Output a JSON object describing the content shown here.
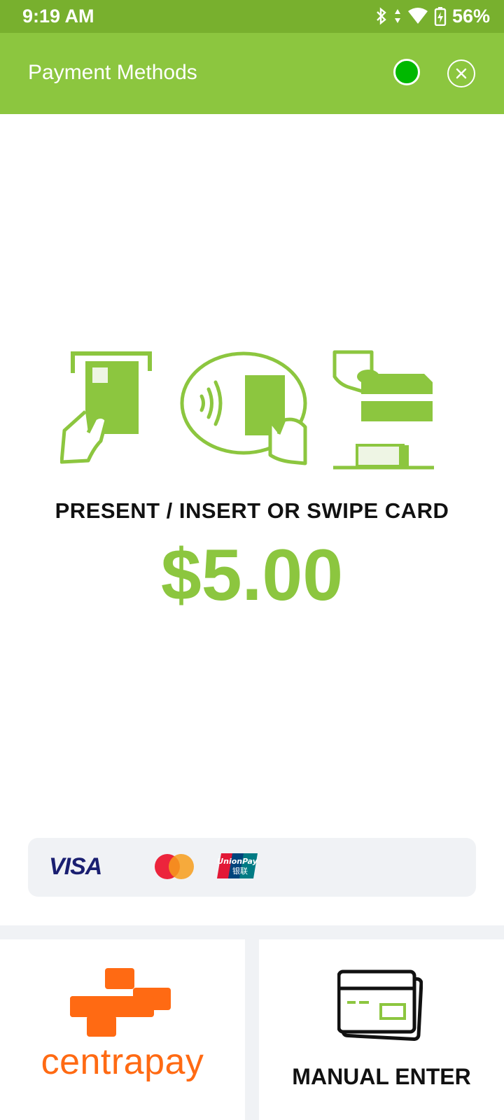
{
  "status_bar": {
    "time": "9:19 AM",
    "battery_percent": "56%",
    "icons": [
      "bluetooth-icon",
      "data-arrows-icon",
      "wifi-icon",
      "battery-charging-icon"
    ]
  },
  "app_bar": {
    "title": "Payment Methods",
    "status_indicator_color": "#00b800",
    "close_icon": "close-icon"
  },
  "main": {
    "instruction": "PRESENT / INSERT OR SWIPE CARD",
    "amount": "$5.00",
    "accent_color": "#8cc63f",
    "illustrations": [
      "insert-card-icon",
      "contactless-tap-icon",
      "swipe-card-icon"
    ]
  },
  "accepted_cards": {
    "visa_label": "VISA",
    "unionpay_label": "UnionPay",
    "unionpay_chinese": "银联",
    "logos": [
      "visa-logo",
      "mastercard-logo",
      "unionpay-logo"
    ]
  },
  "options": {
    "centrapay_label": "centrapay",
    "centrapay_color": "#ff6a13",
    "manual_label": "MANUAL ENTER"
  }
}
